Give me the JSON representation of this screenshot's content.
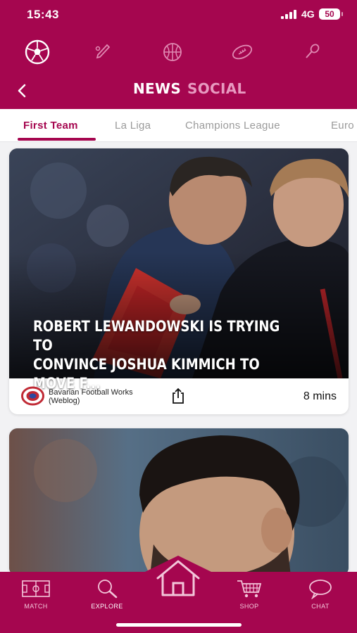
{
  "status": {
    "time": "15:43",
    "network": "4G",
    "battery": "50"
  },
  "sports": [
    "football-icon",
    "cricket-icon",
    "basketball-icon",
    "rugby-icon",
    "tennis-icon"
  ],
  "header": {
    "tabs": [
      "NEWS",
      "SOCIAL"
    ],
    "active_tab": "NEWS"
  },
  "subtabs": [
    "First Team",
    "La Liga",
    "Champions League",
    "Euro"
  ],
  "articles": [
    {
      "headline": "ROBERT LEWANDOWSKI IS TRYING TO\nCONVINCE JOSHUA KIMMICH TO MOVE F...",
      "source": "Bavarian Football Works (Weblog)",
      "time": "8 mins"
    }
  ],
  "bottom_nav": [
    "MATCH",
    "EXPLORE",
    "SHOP",
    "CHAT"
  ],
  "colors": {
    "brand": "#a5064f",
    "tab_inactive": "#e79ac0"
  }
}
